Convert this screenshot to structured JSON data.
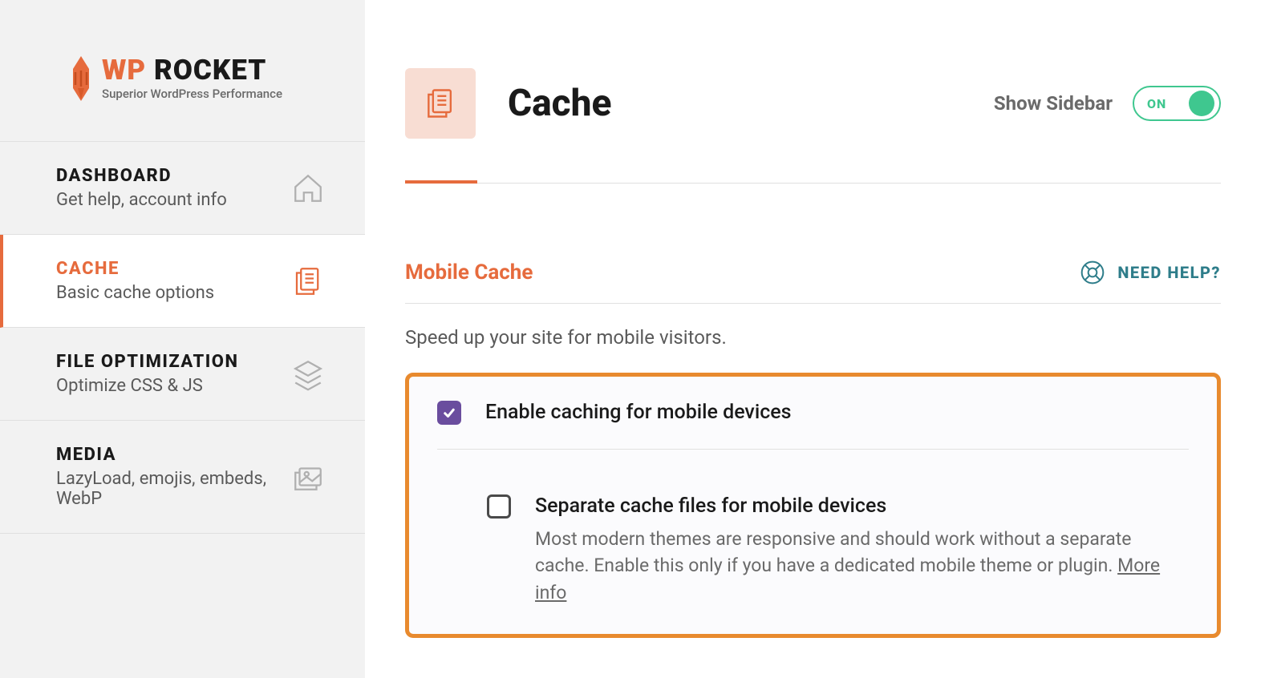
{
  "logo": {
    "wp": "WP",
    "rocket": "ROCKET",
    "tagline": "Superior WordPress Performance"
  },
  "nav": {
    "dashboard": {
      "title": "DASHBOARD",
      "sub": "Get help, account info"
    },
    "cache": {
      "title": "CACHE",
      "sub": "Basic cache options"
    },
    "file": {
      "title": "FILE OPTIMIZATION",
      "sub": "Optimize CSS & JS"
    },
    "media": {
      "title": "MEDIA",
      "sub": "LazyLoad, emojis, embeds, WebP"
    }
  },
  "header": {
    "title": "Cache",
    "showSidebar": "Show Sidebar",
    "toggle": "ON"
  },
  "help": {
    "label": "NEED HELP?"
  },
  "section": {
    "title": "Mobile Cache",
    "desc": "Speed up your site for mobile visitors.",
    "opt1": "Enable caching for mobile devices",
    "opt2": "Separate cache files for mobile devices",
    "opt2desc": "Most modern themes are responsive and should work without a separate cache. Enable this only if you have a dedicated mobile theme or plugin. ",
    "moreInfo": "More info"
  }
}
